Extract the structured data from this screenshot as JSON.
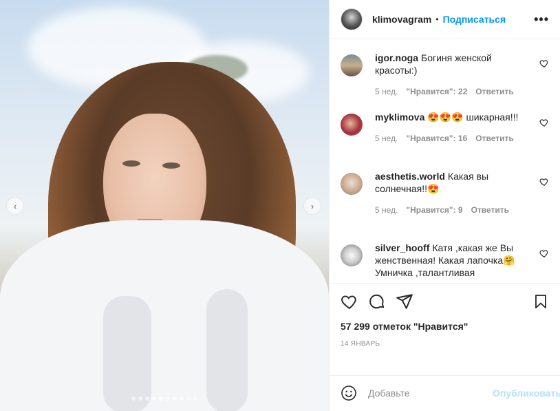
{
  "post": {
    "author": "klimovagram",
    "bullet": "•",
    "follow_label": "Подписаться",
    "more_icon": "more-icon",
    "more_label": "•••",
    "carousel": {
      "prev_label": "‹",
      "next_label": "›",
      "total": 10,
      "active_index": 4
    }
  },
  "comments": [
    {
      "user": "igor.noga",
      "text": "Богиня женской красоты:)",
      "age": "5 нед.",
      "likes": "\"Нравится\": 22",
      "reply": "Ответить"
    },
    {
      "user": "myklimova",
      "text": "😍😍😍 шикарная!!!",
      "age": "5 нед.",
      "likes": "\"Нравится\": 16",
      "reply": "Ответить"
    },
    {
      "user": "aesthetis.world",
      "text": "Какая вы солнечная!!😍",
      "age": "5 нед.",
      "likes": "\"Нравится\": 9",
      "reply": "Ответить"
    },
    {
      "user": "silver_hooff",
      "text": "Катя ,какая же Вы женственная! Какая лапочка🤗 Умничка ,талантливая"
    }
  ],
  "stats": {
    "likes_text": "57 299 отметок \"Нравится\"",
    "date": "14 ЯНВАРЬ"
  },
  "composer": {
    "placeholder": "Добавьте",
    "publish_label": "Опубликовать"
  },
  "icons": [
    "heart-icon",
    "comment-icon",
    "share-icon",
    "bookmark-icon",
    "emoji-icon"
  ]
}
